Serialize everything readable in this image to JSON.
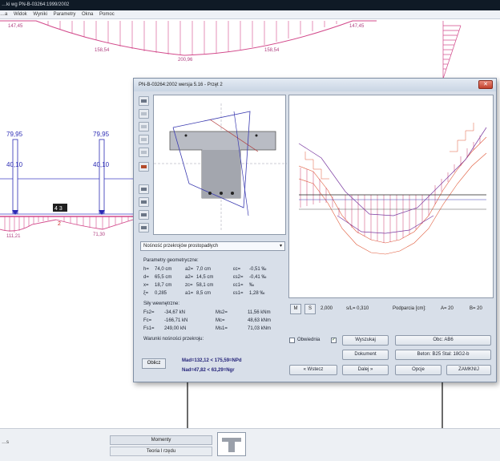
{
  "main_window": {
    "title": "…ki wg PN-B-03264:1999/2002",
    "menu": [
      "…a",
      "Widok",
      "Wyniki",
      "Parametry",
      "Okna",
      "Pomoc"
    ]
  },
  "background_diagram": {
    "top_labels": [
      "147,45",
      "158,54",
      "200,96",
      "158,54",
      "147,45"
    ],
    "left_force_1": "79,95",
    "left_force_2": "79,95",
    "mid_force_1": "40,10",
    "mid_force_2": "40,10",
    "node_badge": "4 3",
    "node_mark": "2",
    "bottom_left_value": "111,21",
    "bottom_mid_value": "71,30",
    "colors": {
      "moment_fill": "#d2488a",
      "axis": "#4343c8",
      "force": "#2b2bb4"
    }
  },
  "dialog": {
    "title": "PN-B-03264:2002 wersja 5.16 - Przęt 2",
    "close_icon": "close-icon",
    "mode_select": "Nośność przekrojów prostopadłych",
    "geom_header": "Parametry geometryczne:",
    "geom_rows": [
      [
        "h=",
        "74,0 cm",
        "a2=",
        "7,0 cm",
        "εc=",
        "-0,51 ‰"
      ],
      [
        "d=",
        "65,5 cm",
        "a2=",
        "14,5 cm",
        "εs2=",
        "-0,41 ‰"
      ],
      [
        "x=",
        "18,7 cm",
        "zc=",
        "58,1 cm",
        "εc1=",
        "‰"
      ],
      [
        "ξ=",
        "0,285",
        "a1=",
        "8,5 cm",
        "εs1=",
        "1,28 ‰"
      ]
    ],
    "forces_header": "Siły wewnętrzne:",
    "force_rows": [
      [
        "Fs2=",
        "-34,67 kN",
        "Ms2=",
        "11,56 kNm"
      ],
      [
        "Fc=",
        "-166,71 kN",
        "Mc=",
        "48,63 kNm"
      ],
      [
        "Fs1=",
        "249,00 kN",
        "Ms1=",
        "71,03 kNm"
      ]
    ],
    "capacity_header": "Warunki nośności przekroju:",
    "obl_button": "Oblicz",
    "result_1": "Mad=132,12 < 175,59=NPd",
    "result_2": "Nad=47,82 < 63,29=Ngr",
    "ctrl": {
      "m_button": "M",
      "s_button": "S",
      "spacing_value": "2,000",
      "ratio_label": "s/L= 0,310",
      "supports_label": "Podparcia [cm]:",
      "a_label": "A= 20",
      "b_label": "B= 20"
    },
    "buttons": {
      "envelope_label": "Obwiednia",
      "search_label": "Wyszukaj",
      "loads_label": "Obc: AB6",
      "document_label": "Dokument",
      "materials_label": "Beton: B25   Stal: 18G2-b",
      "back_label": "« Wstecz",
      "next_label": "Dalej »",
      "options_label": "Opcje",
      "close_label": "ZAMKNIJ"
    }
  },
  "status_bar": {
    "left_text": "…s",
    "tab_moments": "Momenty",
    "tab_theory": "Teoria I rzędu",
    "section_icon": "t-beam-icon"
  }
}
